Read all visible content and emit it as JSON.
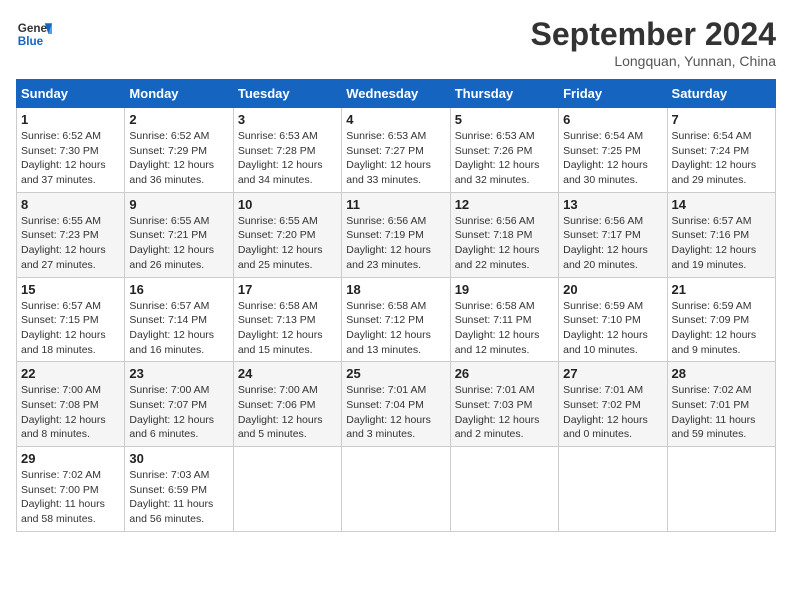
{
  "header": {
    "logo_line1": "General",
    "logo_line2": "Blue",
    "month": "September 2024",
    "location": "Longquan, Yunnan, China"
  },
  "days_of_week": [
    "Sunday",
    "Monday",
    "Tuesday",
    "Wednesday",
    "Thursday",
    "Friday",
    "Saturday"
  ],
  "weeks": [
    [
      {
        "day": 1,
        "rise": "6:52 AM",
        "set": "7:30 PM",
        "hours": "12 hours",
        "mins": "37 minutes"
      },
      {
        "day": 2,
        "rise": "6:52 AM",
        "set": "7:29 PM",
        "hours": "12 hours",
        "mins": "36 minutes"
      },
      {
        "day": 3,
        "rise": "6:53 AM",
        "set": "7:28 PM",
        "hours": "12 hours",
        "mins": "34 minutes"
      },
      {
        "day": 4,
        "rise": "6:53 AM",
        "set": "7:27 PM",
        "hours": "12 hours",
        "mins": "33 minutes"
      },
      {
        "day": 5,
        "rise": "6:53 AM",
        "set": "7:26 PM",
        "hours": "12 hours",
        "mins": "32 minutes"
      },
      {
        "day": 6,
        "rise": "6:54 AM",
        "set": "7:25 PM",
        "hours": "12 hours",
        "mins": "30 minutes"
      },
      {
        "day": 7,
        "rise": "6:54 AM",
        "set": "7:24 PM",
        "hours": "12 hours",
        "mins": "29 minutes"
      }
    ],
    [
      {
        "day": 8,
        "rise": "6:55 AM",
        "set": "7:23 PM",
        "hours": "12 hours",
        "mins": "27 minutes"
      },
      {
        "day": 9,
        "rise": "6:55 AM",
        "set": "7:21 PM",
        "hours": "12 hours",
        "mins": "26 minutes"
      },
      {
        "day": 10,
        "rise": "6:55 AM",
        "set": "7:20 PM",
        "hours": "12 hours",
        "mins": "25 minutes"
      },
      {
        "day": 11,
        "rise": "6:56 AM",
        "set": "7:19 PM",
        "hours": "12 hours",
        "mins": "23 minutes"
      },
      {
        "day": 12,
        "rise": "6:56 AM",
        "set": "7:18 PM",
        "hours": "12 hours",
        "mins": "22 minutes"
      },
      {
        "day": 13,
        "rise": "6:56 AM",
        "set": "7:17 PM",
        "hours": "12 hours",
        "mins": "20 minutes"
      },
      {
        "day": 14,
        "rise": "6:57 AM",
        "set": "7:16 PM",
        "hours": "12 hours",
        "mins": "19 minutes"
      }
    ],
    [
      {
        "day": 15,
        "rise": "6:57 AM",
        "set": "7:15 PM",
        "hours": "12 hours",
        "mins": "18 minutes"
      },
      {
        "day": 16,
        "rise": "6:57 AM",
        "set": "7:14 PM",
        "hours": "12 hours",
        "mins": "16 minutes"
      },
      {
        "day": 17,
        "rise": "6:58 AM",
        "set": "7:13 PM",
        "hours": "12 hours",
        "mins": "15 minutes"
      },
      {
        "day": 18,
        "rise": "6:58 AM",
        "set": "7:12 PM",
        "hours": "12 hours",
        "mins": "13 minutes"
      },
      {
        "day": 19,
        "rise": "6:58 AM",
        "set": "7:11 PM",
        "hours": "12 hours",
        "mins": "12 minutes"
      },
      {
        "day": 20,
        "rise": "6:59 AM",
        "set": "7:10 PM",
        "hours": "12 hours",
        "mins": "10 minutes"
      },
      {
        "day": 21,
        "rise": "6:59 AM",
        "set": "7:09 PM",
        "hours": "12 hours",
        "mins": "9 minutes"
      }
    ],
    [
      {
        "day": 22,
        "rise": "7:00 AM",
        "set": "7:08 PM",
        "hours": "12 hours",
        "mins": "8 minutes"
      },
      {
        "day": 23,
        "rise": "7:00 AM",
        "set": "7:07 PM",
        "hours": "12 hours",
        "mins": "6 minutes"
      },
      {
        "day": 24,
        "rise": "7:00 AM",
        "set": "7:06 PM",
        "hours": "12 hours",
        "mins": "5 minutes"
      },
      {
        "day": 25,
        "rise": "7:01 AM",
        "set": "7:04 PM",
        "hours": "12 hours",
        "mins": "3 minutes"
      },
      {
        "day": 26,
        "rise": "7:01 AM",
        "set": "7:03 PM",
        "hours": "12 hours",
        "mins": "2 minutes"
      },
      {
        "day": 27,
        "rise": "7:01 AM",
        "set": "7:02 PM",
        "hours": "12 hours",
        "mins": "0 minutes"
      },
      {
        "day": 28,
        "rise": "7:02 AM",
        "set": "7:01 PM",
        "hours": "11 hours",
        "mins": "59 minutes"
      }
    ],
    [
      {
        "day": 29,
        "rise": "7:02 AM",
        "set": "7:00 PM",
        "hours": "11 hours",
        "mins": "58 minutes"
      },
      {
        "day": 30,
        "rise": "7:03 AM",
        "set": "6:59 PM",
        "hours": "11 hours",
        "mins": "56 minutes"
      },
      null,
      null,
      null,
      null,
      null
    ]
  ]
}
